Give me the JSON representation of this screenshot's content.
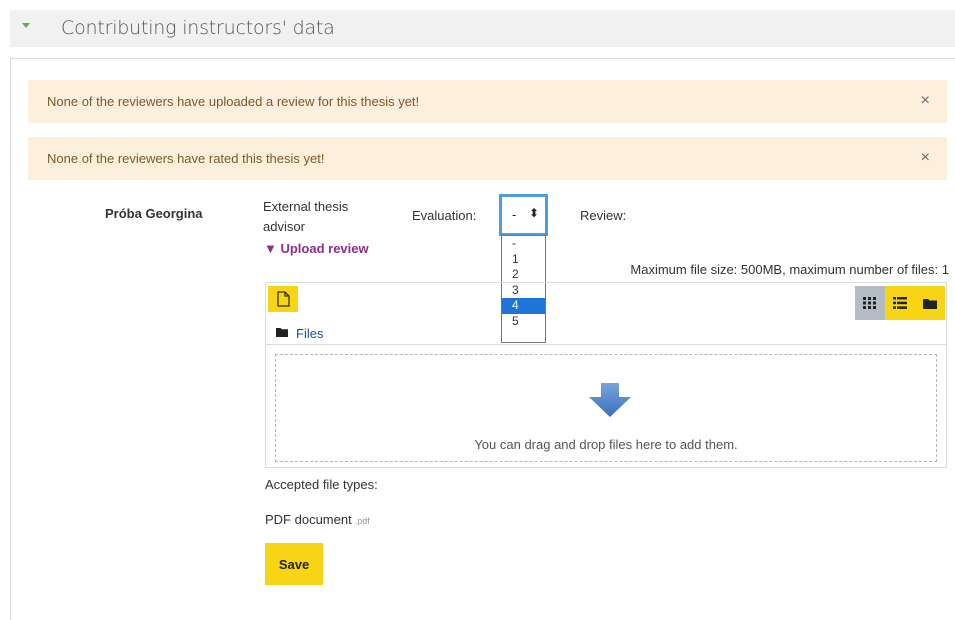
{
  "section": {
    "title": "Contributing instructors' data"
  },
  "alerts": [
    {
      "text": "None of the reviewers have uploaded a review for this thesis yet!",
      "close": "×"
    },
    {
      "text": "None of the reviewers have rated this thesis yet!",
      "close": "×"
    }
  ],
  "reviewer": {
    "name": "Próba Georgina",
    "role": "External thesis advisor",
    "upload_toggle": "▼ Upload review",
    "evaluation_label": "Evaluation:",
    "evaluation_value": "-",
    "evaluation_options": [
      "-",
      "1",
      "2",
      "3",
      "4",
      "5"
    ],
    "evaluation_highlighted": "4",
    "review_label": "Review:"
  },
  "filepicker": {
    "limits": "Maximum file size: 500MB, maximum number of files: 1",
    "breadcrumb": "Files",
    "drop_text": "You can drag and drop files here to add them.",
    "accepted_label": "Accepted file types:",
    "accepted_type": "PDF document",
    "accepted_ext": ".pdf"
  },
  "actions": {
    "save_label": "Save"
  },
  "colors": {
    "accent_yellow": "#f7d514",
    "alert_bg": "#fcefdc",
    "link_purple": "#8e2c8e",
    "select_focus": "#4f9be2",
    "option_highlight": "#1e75d8"
  }
}
